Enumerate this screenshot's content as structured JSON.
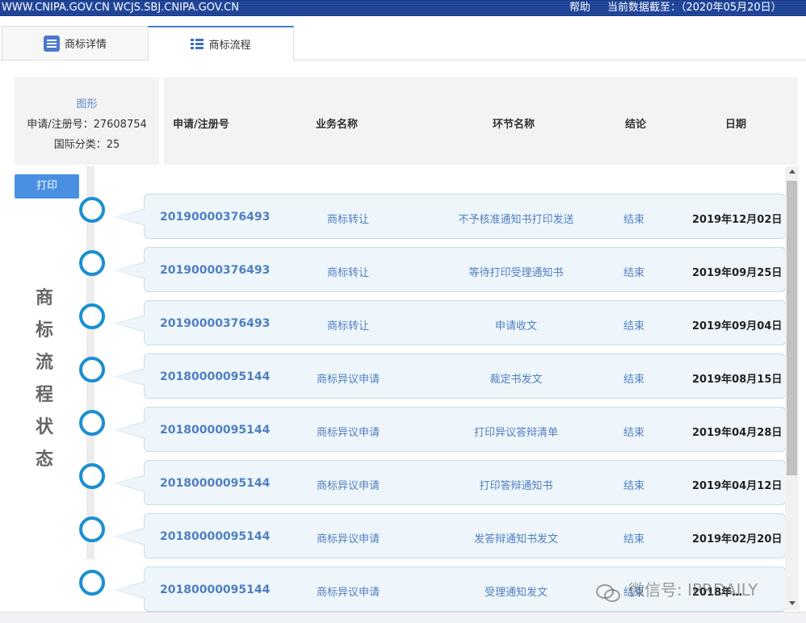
{
  "topbar": {
    "domains": "WWW.CNIPA.GOV.CN WCJS.SBJ.CNIPA.GOV.CN",
    "help": "帮助",
    "as_of": "当前数据截至：（2020年05月20日）"
  },
  "tabs": [
    {
      "label": "商标详情",
      "icon": "document-list-icon"
    },
    {
      "label": "商标流程",
      "icon": "bullet-list-icon"
    }
  ],
  "info": {
    "figure": "图形",
    "reg_no": "申请/注册号：27608754",
    "intl_class": "国际分类：25"
  },
  "columns": {
    "reg_no": "申请/注册号",
    "business": "业务名称",
    "step": "环节名称",
    "result": "结论",
    "date": "日期"
  },
  "print_label": "打印",
  "side_title": [
    "商",
    "标",
    "流",
    "程",
    "状",
    "态"
  ],
  "rows": [
    {
      "no": "20190000376493",
      "business": "商标转让",
      "step": "不予核准通知书打印发送",
      "result": "结束",
      "date": "2019年12月02日"
    },
    {
      "no": "20190000376493",
      "business": "商标转让",
      "step": "等待打印受理通知书",
      "result": "结束",
      "date": "2019年09月25日"
    },
    {
      "no": "20190000376493",
      "business": "商标转让",
      "step": "申请收文",
      "result": "结束",
      "date": "2019年09月04日"
    },
    {
      "no": "20180000095144",
      "business": "商标异议申请",
      "step": "裁定书发文",
      "result": "结束",
      "date": "2019年08月15日"
    },
    {
      "no": "20180000095144",
      "business": "商标异议申请",
      "step": "打印异议答辩清单",
      "result": "结束",
      "date": "2019年04月28日"
    },
    {
      "no": "20180000095144",
      "business": "商标异议申请",
      "step": "打印答辩通知书",
      "result": "结束",
      "date": "2019年04月12日"
    },
    {
      "no": "20180000095144",
      "business": "商标异议申请",
      "step": "发答辩通知书发文",
      "result": "结束",
      "date": "2019年02月20日"
    },
    {
      "no": "20180000095144",
      "business": "商标异议申请",
      "step": "受理通知发文",
      "result": "结束",
      "date": "2018年…"
    }
  ],
  "watermark": "微信号: IPRDAILY"
}
